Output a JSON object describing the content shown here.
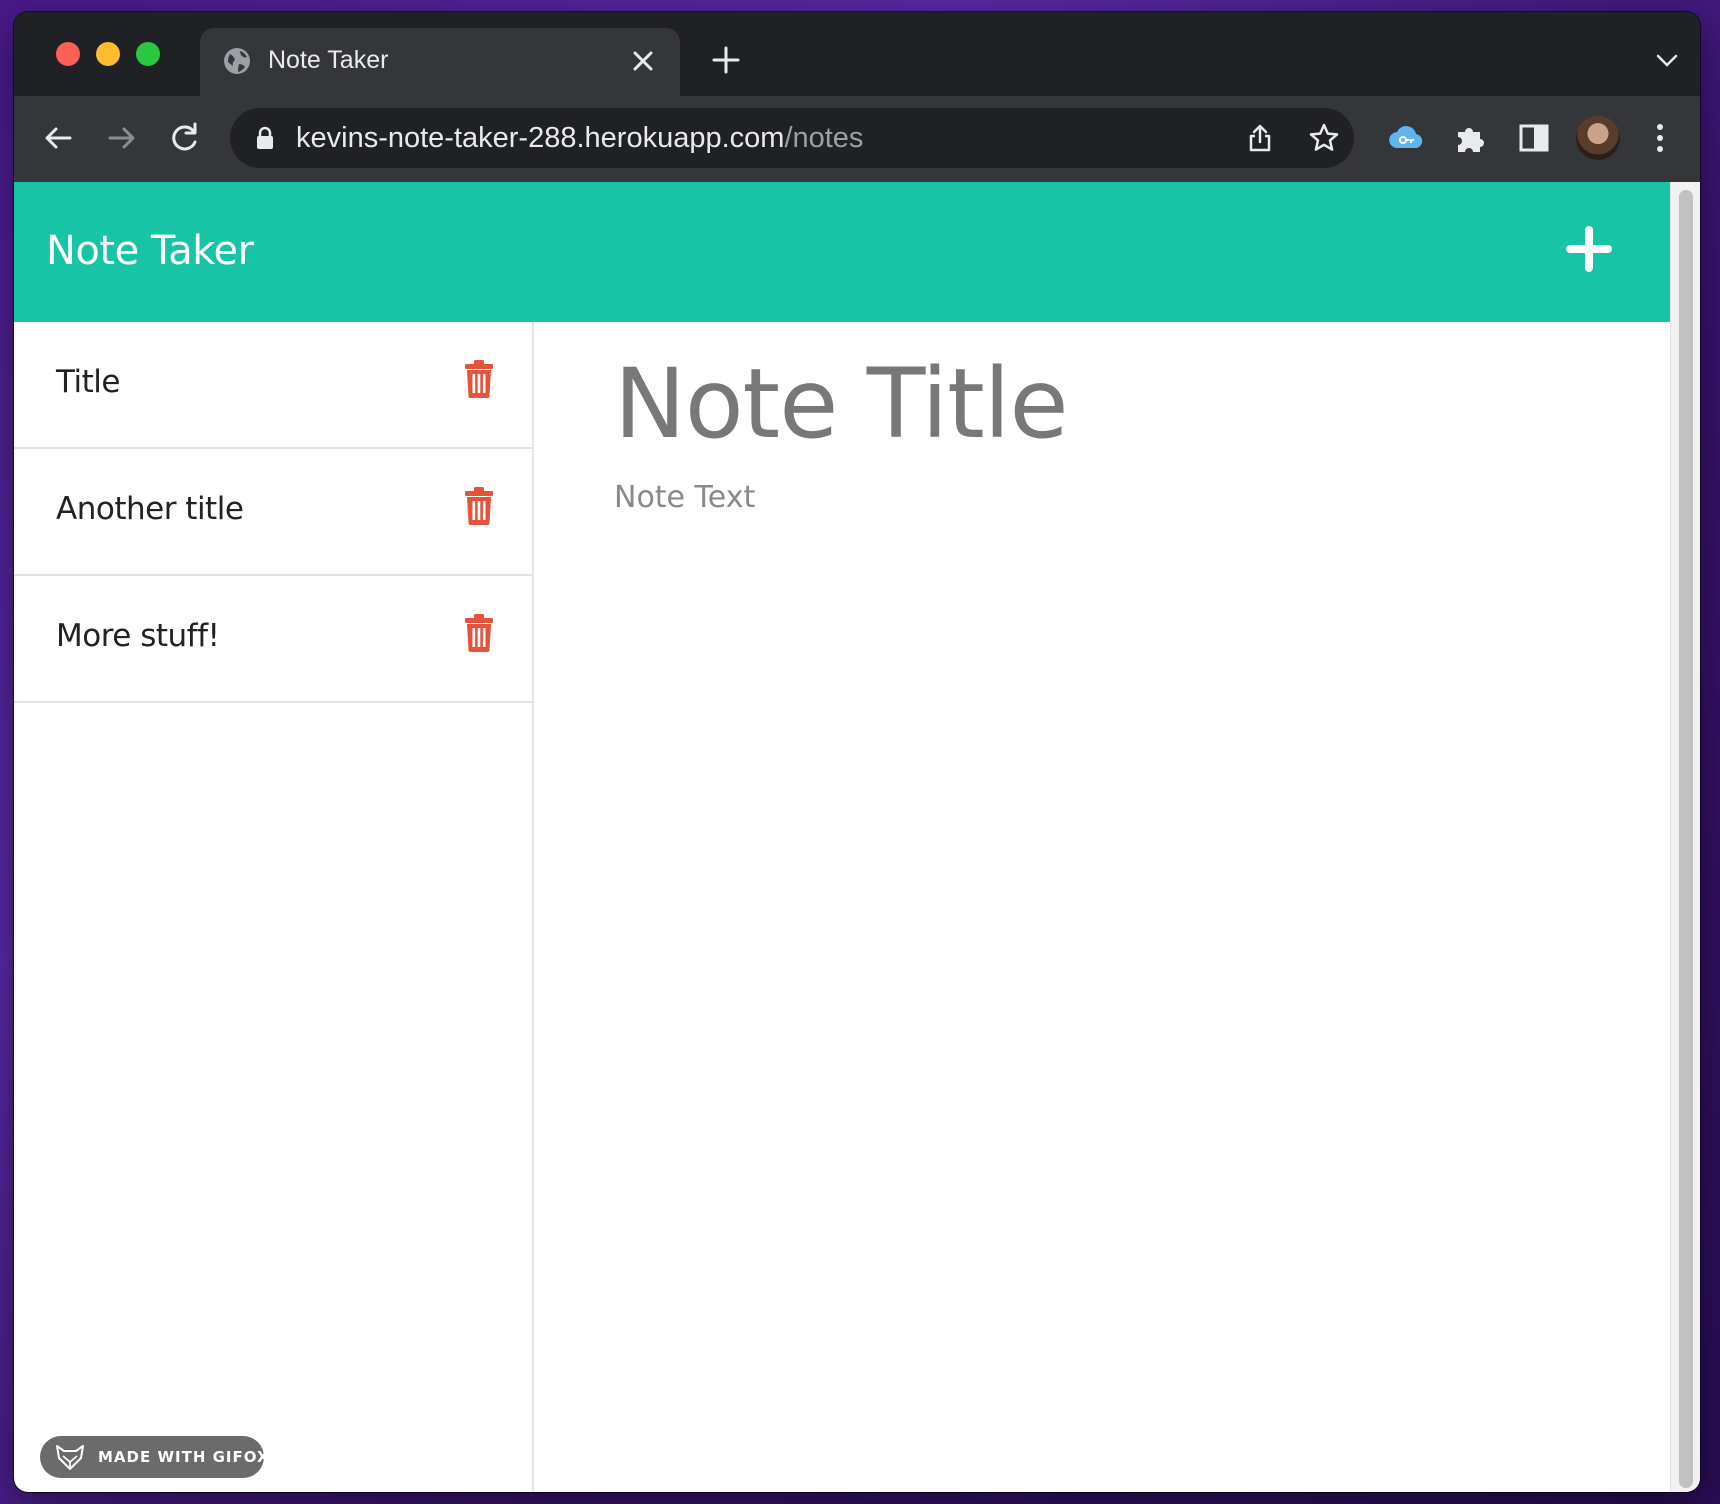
{
  "browser": {
    "tab": {
      "title": "Note Taker"
    },
    "address_bar": {
      "host": "kevins-note-taker-288.herokuapp.com",
      "path": "/notes"
    }
  },
  "app": {
    "brand": "Note Taker",
    "accent_color": "#17c4a6",
    "delete_color": "#e5533d",
    "notes": [
      {
        "title": "Title"
      },
      {
        "title": "Another title"
      },
      {
        "title": "More stuff!"
      }
    ],
    "editor": {
      "title_placeholder": "Note Title",
      "text_placeholder": "Note Text"
    }
  },
  "watermark": {
    "label": "MADE WITH GIFOX"
  }
}
